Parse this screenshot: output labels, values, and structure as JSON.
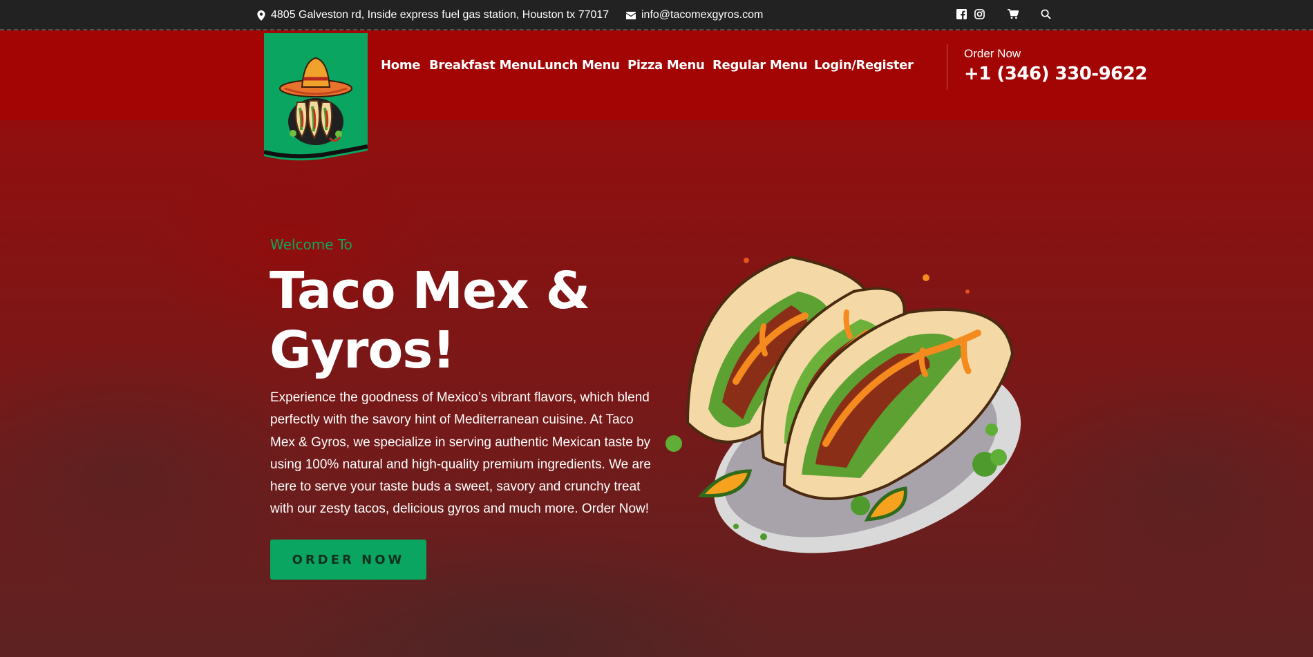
{
  "topbar": {
    "address": "4805 Galveston rd, Inside express fuel gas station, Houston tx 77017",
    "email": "info@tacomexgyros.com",
    "icons": [
      "facebook-icon",
      "instagram-icon",
      "cart-icon",
      "search-icon"
    ]
  },
  "nav": {
    "items": [
      {
        "label": "Home"
      },
      {
        "label": "Breakfast Menu"
      },
      {
        "label": "Lunch Menu"
      },
      {
        "label": "Pizza Menu"
      },
      {
        "label": "Regular Menu"
      },
      {
        "label": "Login/Register"
      }
    ]
  },
  "order": {
    "label": "Order Now",
    "phone": "+1 (346) 330-9622"
  },
  "hero": {
    "welcome": "Welcome To",
    "title": "Taco Mex & Gyros!",
    "description": "Experience the goodness of Mexico’s vibrant flavors, which blend perfectly with the savory hint of Mediterranean cuisine. At Taco Mex & Gyros, we specialize in serving authentic Mexican taste by using 100% natural and high-quality premium ingredients. We are here to serve your taste buds a sweet, savory and crunchy treat with our zesty tacos, delicious gyros and much more. Order Now!",
    "button_label": "ORDER NOW"
  },
  "colors": {
    "topbar": "#222222",
    "header": "#a30404",
    "accent_green": "#0aa560",
    "welcome_green": "#10a65c"
  }
}
